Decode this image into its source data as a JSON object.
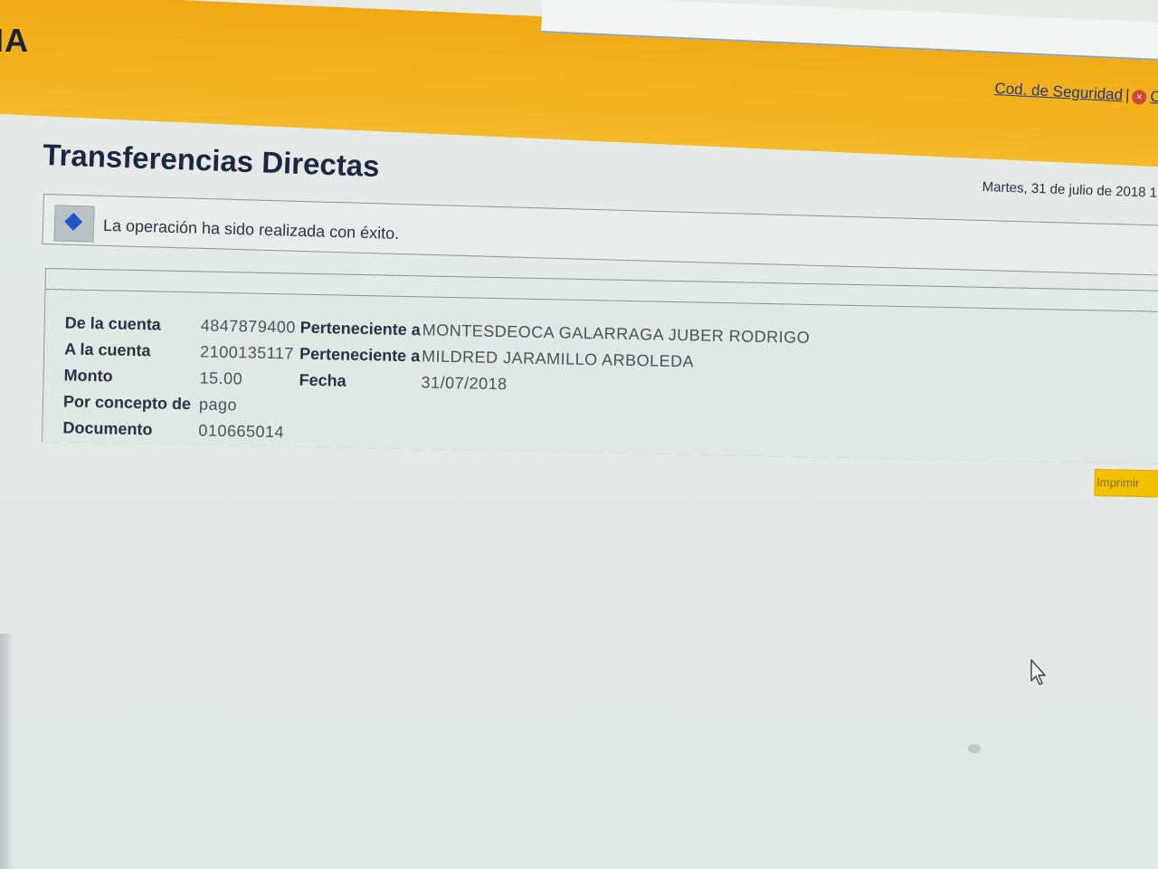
{
  "header": {
    "brand_fragment": "IA",
    "security_code_link": "Cod. de Seguridad",
    "separator": "|",
    "close_link_fragment": "C"
  },
  "page": {
    "title": "Transferencias Directas",
    "date_text": "Martes, 31 de julio de 2018 1",
    "message": "La operación ha sido realizada con éxito."
  },
  "details": {
    "from_account_label": "De la cuenta",
    "from_account_value": "4847879400",
    "from_owner_label": "Perteneciente a",
    "from_owner_value": "MONTESDEOCA GALARRAGA JUBER RODRIGO",
    "to_account_label": "A la cuenta",
    "to_account_value": "2100135117",
    "to_owner_label": "Perteneciente a",
    "to_owner_value": "MILDRED JARAMILLO ARBOLEDA",
    "amount_label": "Monto",
    "amount_value": "15.00",
    "date_label": "Fecha",
    "date_value": "31/07/2018",
    "concept_label": "Por concepto de",
    "concept_value": "pago",
    "document_label": "Documento",
    "document_value": "010665014"
  },
  "actions": {
    "print_label": "Imprimir"
  },
  "colors": {
    "header_orange": "#f2b31e",
    "print_button": "#f2c200",
    "info_icon": "#1f56c8",
    "close_icon": "#d2463a"
  },
  "icons": {
    "info": "info-diamond-icon",
    "close": "close-circle-icon",
    "cursor": "mouse-pointer-icon"
  }
}
